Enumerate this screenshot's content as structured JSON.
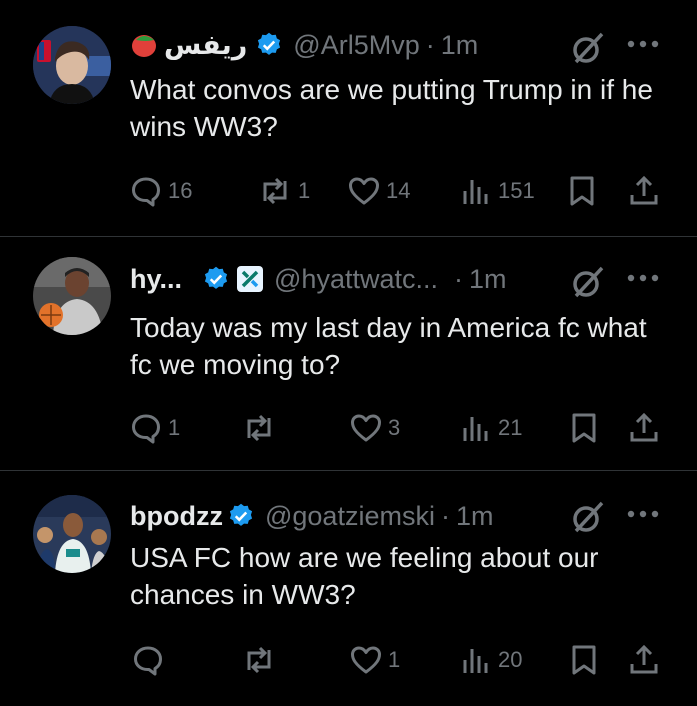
{
  "tweets": [
    {
      "display_name": "ريفس",
      "handle": "@Arl5Mvp",
      "time": "1m",
      "text": "What convos are we putting Trump in if he wins WW3?",
      "replies": "16",
      "reposts": "1",
      "likes": "14",
      "views": "151"
    },
    {
      "display_name": "hy...",
      "handle": "@hyattwatc...",
      "time": "1m",
      "text": "Today was my last day in America fc what fc we moving to?",
      "replies": "1",
      "reposts": "",
      "likes": "3",
      "views": "21"
    },
    {
      "display_name": "bpodzz",
      "handle": "@goatziemski",
      "time": "1m",
      "text": "USA FC how are we feeling about our chances in WW3?",
      "replies": "",
      "reposts": "",
      "likes": "1",
      "views": "20"
    }
  ],
  "separator": "·",
  "colors": {
    "background": "#000000",
    "text": "#e7e9ea",
    "muted": "#71767b",
    "verified": "#1d9bf0",
    "divider": "#2f3336"
  },
  "icons": [
    "verified-badge-icon",
    "grok-icon",
    "more-icon",
    "reply-icon",
    "repost-icon",
    "like-icon",
    "views-icon",
    "bookmark-icon",
    "share-icon"
  ]
}
